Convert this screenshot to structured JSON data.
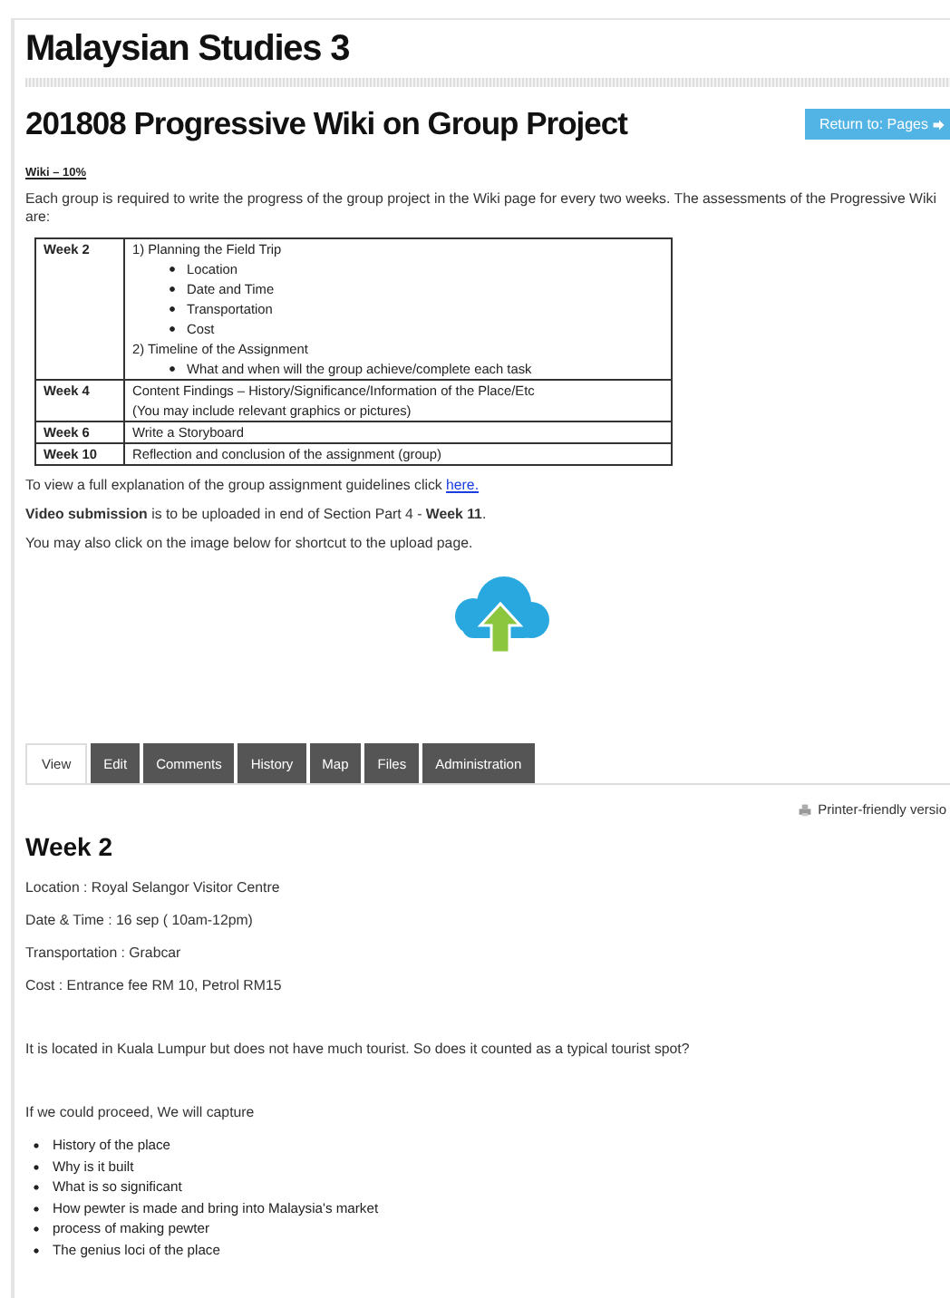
{
  "course_title": "Malaysian Studies 3",
  "page_title": "201808 Progressive Wiki on Group Project",
  "return_button": {
    "label": "Return to: Pages"
  },
  "intro": {
    "heading": "Wiki – 10%",
    "text": "Each group is required to write the progress of the group project in the Wiki page for every two weeks. The assessments of the Progressive Wiki are:"
  },
  "schedule_table": {
    "rows": [
      {
        "week": "Week 2",
        "lines": [
          {
            "kind": "text",
            "text": "1) Planning the Field Trip"
          },
          {
            "kind": "bullet",
            "text": "Location"
          },
          {
            "kind": "bullet",
            "text": "Date and Time"
          },
          {
            "kind": "bullet",
            "text": "Transportation"
          },
          {
            "kind": "bullet",
            "text": "Cost"
          },
          {
            "kind": "text",
            "text": "2) Timeline of the Assignment"
          },
          {
            "kind": "bullet",
            "text": "What and when will the group achieve/complete each task"
          }
        ]
      },
      {
        "week": "Week 4",
        "lines": [
          {
            "kind": "text",
            "text": "Content Findings – History/Significance/Information of the Place/Etc"
          },
          {
            "kind": "text",
            "text": "(You may include relevant graphics or pictures)"
          }
        ]
      },
      {
        "week": "Week 6",
        "lines": [
          {
            "kind": "text",
            "text": "Write a Storyboard"
          }
        ]
      },
      {
        "week": "Week 10",
        "lines": [
          {
            "kind": "text",
            "text": "Reflection and conclusion of the assignment (group)"
          }
        ]
      }
    ]
  },
  "guidelines": {
    "text": "To view a full explanation of the group assignment guidelines click",
    "link": "here."
  },
  "video_note": "**Video submission** is to be uploaded in end of Section Part 4 - **Week 11**.",
  "shortcut_note": "You may also click on the image below for shortcut to the upload page.",
  "tabs": [
    {
      "label": "View",
      "selected": true
    },
    {
      "label": "Edit",
      "selected": false
    },
    {
      "label": "Comments",
      "selected": false
    },
    {
      "label": "History",
      "selected": false
    },
    {
      "label": "Map",
      "selected": false
    },
    {
      "label": "Files",
      "selected": false
    },
    {
      "label": "Administration",
      "selected": false
    }
  ],
  "printer_link": "Printer-friendly versio",
  "content": {
    "heading": "Week 2",
    "details": [
      "Location : Royal Selangor Visitor Centre",
      "Date & Time : 16 sep ( 10am-12pm)",
      "Transportation : Grabcar",
      "Cost : Entrance fee RM 10, Petrol RM15"
    ],
    "question": "It is located in Kuala Lumpur but does not have much tourist. So does it counted as a typical tourist spot?",
    "capture_intro": "If we could proceed, We will capture",
    "capture_items": [
      "History of the place",
      "Why is it built",
      "What is so significant",
      "How pewter is made and bring into Malaysia's market",
      "process of making pewter",
      "The genius loci of the place"
    ]
  }
}
